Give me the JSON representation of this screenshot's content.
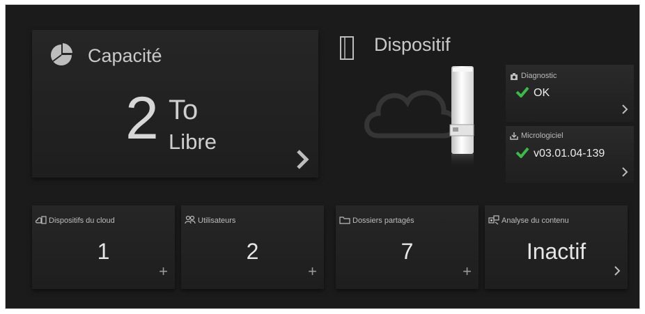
{
  "capacity": {
    "title": "Capacité",
    "amount": "2",
    "unit": "To",
    "status": "Libre",
    "icon": "pie-chart-icon"
  },
  "device": {
    "title": "Dispositif",
    "icon": "device-outline-icon",
    "diagnostic": {
      "label": "Diagnostic",
      "value": "OK",
      "icon": "camera-icon"
    },
    "firmware": {
      "label": "Micrologiciel",
      "value": "v03.01.04-139",
      "icon": "download-icon"
    }
  },
  "tiles": [
    {
      "label": "Dispositifs du cloud",
      "value": "1",
      "icon": "cloud-devices-icon",
      "action": "plus"
    },
    {
      "label": "Utilisateurs",
      "value": "2",
      "icon": "users-icon",
      "action": "plus"
    },
    {
      "label": "Dossiers partagés",
      "value": "7",
      "icon": "folder-icon",
      "action": "plus"
    },
    {
      "label": "Analyse du contenu",
      "value": "Inactif",
      "icon": "content-scan-icon",
      "action": "chevron"
    }
  ],
  "colors": {
    "background": "#1b1b1b",
    "panel": "#232323",
    "text": "#d7d7d7",
    "check": "#3db94a"
  }
}
